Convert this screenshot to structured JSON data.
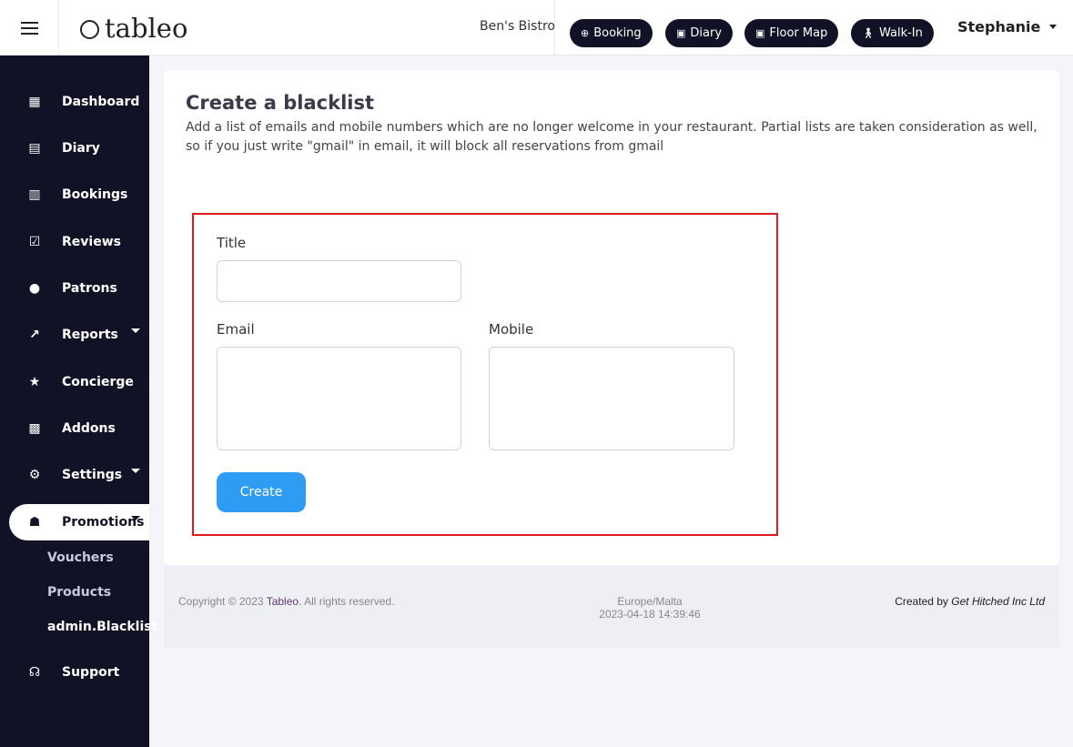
{
  "app": {
    "logo_text": "tableo",
    "venue": "Ben's Bistro"
  },
  "topbar": {
    "buttons": [
      {
        "label": "Booking",
        "icon": "plus-circle-icon"
      },
      {
        "label": "Diary",
        "icon": "calendar-icon"
      },
      {
        "label": "Floor Map",
        "icon": "calendar-icon"
      },
      {
        "label": "Walk-In",
        "icon": "walking-person-icon"
      }
    ],
    "user": "Stephanie"
  },
  "sidebar": {
    "items": [
      {
        "label": "Dashboard",
        "icon": "dashboard-icon"
      },
      {
        "label": "Diary",
        "icon": "calendar-icon"
      },
      {
        "label": "Bookings",
        "icon": "bookings-icon"
      },
      {
        "label": "Reviews",
        "icon": "reviews-icon"
      },
      {
        "label": "Patrons",
        "icon": "person-icon"
      },
      {
        "label": "Reports",
        "icon": "chart-icon"
      },
      {
        "label": "Concierge",
        "icon": "star-icon"
      },
      {
        "label": "Addons",
        "icon": "addons-icon"
      },
      {
        "label": "Settings",
        "icon": "gear-icon"
      },
      {
        "label": "Promotions",
        "icon": "gift-icon"
      },
      {
        "label": "Support",
        "icon": "headset-icon"
      }
    ],
    "sub_items": [
      {
        "label": "Vouchers"
      },
      {
        "label": "Products"
      },
      {
        "label": "admin.Blacklist"
      }
    ]
  },
  "main": {
    "title": "Create a blacklist",
    "description": "Add a list of emails and mobile numbers which are no longer welcome in your restaurant. Partial lists are taken consideration as well, so if you just write \"gmail\" in email, it will block all reservations from gmail",
    "form": {
      "title_label": "Title",
      "title_value": "",
      "email_label": "Email",
      "email_value": "",
      "mobile_label": "Mobile",
      "mobile_value": "",
      "create_label": "Create"
    }
  },
  "footer": {
    "copyright_prefix": "Copyright © 2023 ",
    "brand": "Tableo",
    "copyright_suffix": ". All rights reserved.",
    "timezone": "Europe/Malta",
    "datetime": "2023-04-18 14:39:46",
    "created_by_prefix": "Created by ",
    "created_by": "Get Hitched Inc Ltd"
  },
  "colors": {
    "sidebar_bg": "#111226",
    "accent_button": "#2f9cf4",
    "highlight_border": "#e0191c"
  }
}
